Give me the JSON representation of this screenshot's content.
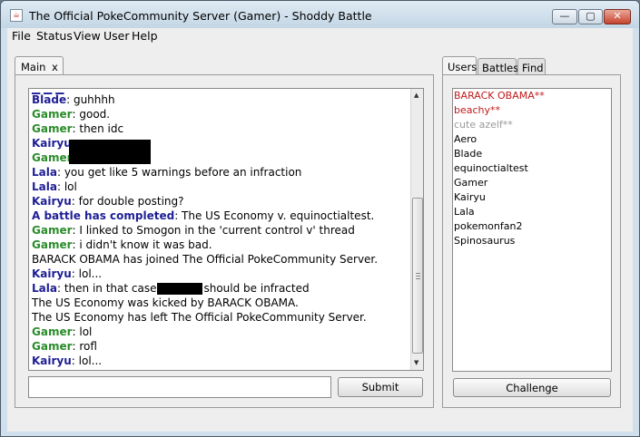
{
  "window": {
    "title": "The Official PokeCommunity Server (Gamer) - Shoddy Battle",
    "minimize": "—",
    "maximize": "▢",
    "close": "✕"
  },
  "menubar": {
    "items": [
      "File",
      "Status",
      "View",
      "User",
      "Help"
    ]
  },
  "left_tabs": [
    {
      "label": "Main",
      "close": "x"
    }
  ],
  "right_tabs": [
    {
      "label": "Users"
    },
    {
      "label": "Battles"
    },
    {
      "label": "Find"
    }
  ],
  "chat": {
    "messages": [
      {
        "name": "Blade",
        "text": ": guhhhh",
        "color": "#1e1e96"
      },
      {
        "name": "Gamer",
        "text": ": good.",
        "color": "#2a8c2a"
      },
      {
        "name": "Gamer",
        "text": ": then idc",
        "color": "#2a8c2a"
      },
      {
        "name": "Kairyu",
        "text": ":",
        "color": "#1e1e96"
      },
      {
        "name": "Gamer",
        "text": ":",
        "color": "#2a8c2a"
      },
      {
        "name": "Lala",
        "text": ": you get like 5 warnings before an infraction",
        "color": "#1e1e96"
      },
      {
        "name": "Lala",
        "text": ": lol",
        "color": "#1e1e96"
      },
      {
        "name": "Kairyu",
        "text": ": for double posting?",
        "color": "#1e1e96"
      },
      {
        "name": "A battle has completed",
        "text": ": The US Economy v. equinoctialtest.",
        "color": "#1e1e96"
      },
      {
        "name": "Gamer",
        "text": ": I linked to Smogon in the 'current control v' thread",
        "color": "#2a8c2a"
      },
      {
        "name": "Gamer",
        "text": ": i didn't know it was bad.",
        "color": "#2a8c2a"
      },
      {
        "name": "",
        "text": "BARACK OBAMA has joined The Official PokeCommunity Server.",
        "color": "#000000"
      },
      {
        "name": "Kairyu",
        "text": ": lol...",
        "color": "#1e1e96"
      },
      {
        "name": "Lala",
        "text": ": then in that case",
        "text2": "should be infracted",
        "color": "#1e1e96"
      },
      {
        "name": "",
        "text": "The US Economy was kicked by BARACK OBAMA.",
        "color": "#000000"
      },
      {
        "name": "",
        "text": "The US Economy has left The Official PokeCommunity Server.",
        "color": "#000000"
      },
      {
        "name": "Gamer",
        "text": ": lol",
        "color": "#2a8c2a"
      },
      {
        "name": "Gamer",
        "text": ": rofl",
        "color": "#2a8c2a"
      },
      {
        "name": "Kairyu",
        "text": ": lol...",
        "color": "#1e1e96"
      }
    ],
    "input_value": "",
    "submit_label": "Submit"
  },
  "users": {
    "list": [
      {
        "name": "BARACK OBAMA**",
        "color": "#c01a1a"
      },
      {
        "name": "beachy**",
        "color": "#c01a1a"
      },
      {
        "name": "cute azelf**",
        "color": "#9a9a9a"
      },
      {
        "name": "Aero",
        "color": "#000000"
      },
      {
        "name": "Blade",
        "color": "#000000"
      },
      {
        "name": "equinoctialtest",
        "color": "#000000"
      },
      {
        "name": "Gamer",
        "color": "#000000"
      },
      {
        "name": "Kairyu",
        "color": "#000000"
      },
      {
        "name": "Lala",
        "color": "#000000"
      },
      {
        "name": "pokemonfan2",
        "color": "#000000"
      },
      {
        "name": "Spinosaurus",
        "color": "#000000"
      }
    ],
    "challenge_label": "Challenge"
  }
}
